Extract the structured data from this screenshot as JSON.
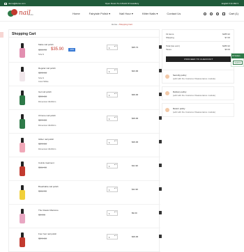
{
  "topbar": {
    "email": "demo@demo.com",
    "promo": "Open Doors To A World Of Jewellery",
    "lang_currency": "English ▾  $ USD ▾"
  },
  "header": {
    "logo_text": "nail",
    "logo_sub": "studio",
    "nav": [
      "Home",
      "Fairytale Polish ▾",
      "Nail Hour ▾",
      "Kitter Nails ▾",
      "Contact Us"
    ],
    "cart_label": "Cart (1)",
    "icons": [
      "search-icon",
      "user-icon",
      "heart-icon",
      "cart-icon"
    ]
  },
  "breadcrumb": {
    "home": "Home",
    "sep": "›",
    "current": "Shopping Cart"
  },
  "cart": {
    "title": "Shopping Cart",
    "items": [
      {
        "name": "Matte nail polish",
        "old_price": "$39.72",
        "price": "$35.90",
        "discount": "-10%",
        "attrs": [
          "Size:S"
        ],
        "qty": "1",
        "total": "$35.72",
        "color": "#e28fb0"
      },
      {
        "name": "Regular nail polish",
        "old_price": "",
        "price": "$23.90",
        "discount": "",
        "attrs": [
          "Size:S",
          "Color:White"
        ],
        "qty": "1",
        "total": "$23.90",
        "color": "#f0e6ea"
      },
      {
        "name": "Gel nail polish",
        "old_price": "",
        "price": "$39.00",
        "discount": "",
        "attrs": [
          "Dimension:40x60cm"
        ],
        "qty": "1",
        "total": "$39.00",
        "color": "#2e7a48"
      },
      {
        "name": "Chrome nail polish",
        "old_price": "",
        "price": "$29.00",
        "discount": "",
        "attrs": [
          "Dimension:40x60cm"
        ],
        "qty": "1",
        "total": "$29.00",
        "color": "#2e7a48"
      },
      {
        "name": "Glitter nail polish",
        "old_price": "",
        "price": "$29.00",
        "discount": "",
        "attrs": [
          "Dimension:40x60cm"
        ],
        "qty": "1",
        "total": "$29.00",
        "color": "#f0a8b8"
      },
      {
        "name": "Cuticle treatment",
        "old_price": "",
        "price": "$11.90",
        "discount": "",
        "attrs": [],
        "qty": "1",
        "total": "$11.90",
        "color": "#c23a2f"
      },
      {
        "name": "Breathable nail polish",
        "old_price": "",
        "price": "$11.90",
        "discount": "",
        "attrs": [],
        "qty": "1",
        "total": "$11.90",
        "color": "#f1d03a"
      },
      {
        "name": "The Classic Manicure",
        "old_price": "",
        "price": "$9.00",
        "discount": "",
        "attrs": [],
        "qty": "1",
        "total": "$9.00",
        "color": "#e8a7c2"
      },
      {
        "name": "Four foot nail polish",
        "old_price": "",
        "price": "$29.00",
        "discount": "",
        "attrs": [],
        "qty": "1",
        "total": "$29.00",
        "color": "#c23a2f"
      }
    ]
  },
  "summary": {
    "items_label": "19 items",
    "items_value": "$285.92",
    "shipping_label": "Shipping",
    "shipping_value": "$7.00",
    "total_label": "Total (tax excl.)",
    "total_value": "$286.92",
    "taxes_label": "Taxes",
    "taxes_value": "$0.00",
    "checkout": "PROCEED TO CHECKOUT"
  },
  "policies": [
    {
      "title": "Security policy",
      "desc": "(edit with the Customer Reassurance module)"
    },
    {
      "title": "Delivery policy",
      "desc": "(edit with the Customer Reassurance module)"
    },
    {
      "title": "Return policy",
      "desc": "(edit with the Customer Reassurance module)"
    }
  ],
  "floating": {
    "top": "19 Visitors",
    "button": "DEMOS"
  },
  "colors": {
    "brand_green": "#1f5a3a",
    "accent_red": "#c23a2f"
  }
}
